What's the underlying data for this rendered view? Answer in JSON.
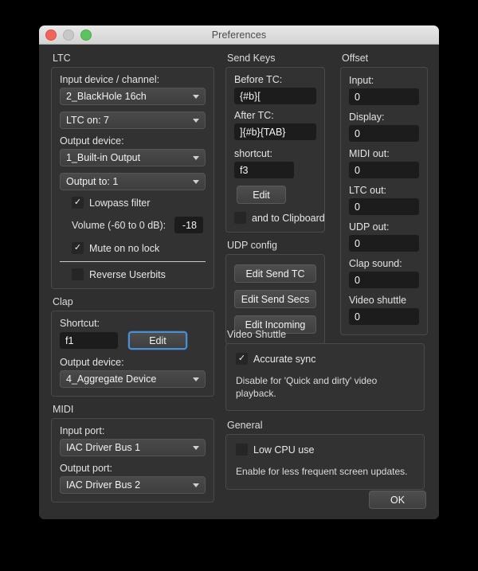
{
  "window": {
    "title": "Preferences",
    "traffic_lights": [
      "close-button",
      "minimize-button",
      "zoom-button"
    ]
  },
  "ltc": {
    "group_label": "LTC",
    "input_device_label": "Input device / channel:",
    "input_device_value": "2_BlackHole 16ch",
    "ltc_on_value": "LTC on: 7",
    "output_device_label": "Output device:",
    "output_device_value": "1_Built-in Output",
    "output_to_value": "Output to: 1",
    "lowpass_label": "Lowpass filter",
    "lowpass_checked": "✓",
    "volume_label": "Volume (-60 to 0 dB):",
    "volume_value": "-18",
    "mute_label": "Mute on no lock",
    "mute_checked": "✓",
    "reverse_label": "Reverse Userbits",
    "reverse_checked": ""
  },
  "clap": {
    "group_label": "Clap",
    "shortcut_label": "Shortcut:",
    "shortcut_value": "f1",
    "edit_label": "Edit",
    "output_device_label": "Output device:",
    "output_device_value": "4_Aggregate Device"
  },
  "midi": {
    "group_label": "MIDI",
    "input_port_label": "Input port:",
    "input_port_value": "IAC Driver Bus 1",
    "output_port_label": "Output port:",
    "output_port_value": "IAC Driver Bus 2"
  },
  "send_keys": {
    "group_label": "Send Keys",
    "before_tc_label": "Before TC:",
    "before_tc_value": "{#b}[",
    "after_tc_label": "After TC:",
    "after_tc_value": "]{#b}{TAB}",
    "shortcut_label": "shortcut:",
    "shortcut_value": "f3",
    "edit_label": "Edit",
    "clipboard_label": "and to Clipboard",
    "clipboard_checked": ""
  },
  "udp": {
    "group_label": "UDP config",
    "buttons": [
      {
        "label": "Edit Send TC"
      },
      {
        "label": "Edit Send Secs"
      },
      {
        "label": "Edit Incoming"
      }
    ]
  },
  "video_shuttle": {
    "group_label": "Video Shuttle",
    "accurate_sync_label": "Accurate sync",
    "accurate_sync_checked": "✓",
    "hint": "Disable for 'Quick and dirty' video playback."
  },
  "general": {
    "group_label": "General",
    "low_cpu_label": "Low CPU use",
    "low_cpu_checked": "",
    "hint": "Enable for less frequent screen updates."
  },
  "offset": {
    "group_label": "Offset",
    "fields": [
      {
        "label": "Input:",
        "value": "0"
      },
      {
        "label": "Display:",
        "value": "0"
      },
      {
        "label": "MIDI out:",
        "value": "0"
      },
      {
        "label": "LTC out:",
        "value": "0"
      },
      {
        "label": "UDP out:",
        "value": "0"
      },
      {
        "label": "Clap sound:",
        "value": "0"
      },
      {
        "label": "Video shuttle",
        "value": "0"
      }
    ]
  },
  "footer": {
    "ok_label": "OK"
  },
  "colors": {
    "window_bg": "#2f2f2f",
    "group_bg": "#323232",
    "field_bg": "#1c1c1c",
    "accent_focus": "#4a90d9",
    "close": "#f0655a",
    "minimize": "#c8c8c8",
    "zoom": "#5cc45c"
  }
}
